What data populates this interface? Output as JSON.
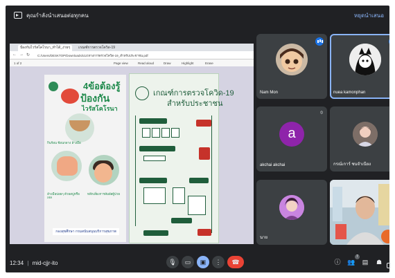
{
  "meeting": {
    "presenting_banner": "คุณกำลังนำเสนอต่อทุกคน",
    "stop_presenting": "หยุดนำเสนอ",
    "time": "12:34",
    "meeting_code": "mid-cjjr-ito",
    "participants_count": "7"
  },
  "shared_screen": {
    "tabs": [
      "ป้องกันไวรัสโคโรนา_ทำได้_ง่ายๆ",
      "เกณฑ์การตรวจโควิด-19"
    ],
    "address": "C:/Users/DESKTOP/Downloads/แนวทางการตรวจโควิด-19_สำหรับประชาชน.pdf",
    "page_indicator": "1 of 2",
    "toolbar": [
      "Page view",
      "Read aloud",
      "Draw",
      "Highlight",
      "Erase"
    ],
    "poster_left": {
      "title_line1": "4ข้อต้องรู้",
      "title_line2": "ป้องกัน",
      "title_line3": "ไวรัสโคโรนา",
      "tip1": "กินร้อน ช้อนกลาง ล้างมือ",
      "tip3": "ล้างมือบ่อยๆ ด้วยสบู่หรือเจล",
      "tip4": "หลีกเลี่ยงการสัมผัสผู้ป่วย",
      "footer": "กองสุขศึกษา กรมสนับสนุนบริการสุขภาพ"
    },
    "poster_right": {
      "title_line1": "เกณฑ์การตรวจโควิด-19",
      "title_line2": "สำหรับประชาชน"
    }
  },
  "participants": [
    {
      "name": "Nam Mon",
      "status": "speaking"
    },
    {
      "name": "nuea kamonphan",
      "status": "speaking",
      "initial": ""
    },
    {
      "name": "akchai akchai",
      "initial": "a",
      "status": "muted"
    },
    {
      "name": "กรณ์เการ์ ชนจำเนียง",
      "status": "muted"
    },
    {
      "name": "นาย",
      "status": ""
    },
    {
      "name": "",
      "status": ""
    }
  ],
  "colors": {
    "background": "#202124",
    "tile": "#3c4043",
    "accent": "#8ab4f8",
    "end_call": "#ea4335",
    "avatar_purple": "#8e24aa"
  },
  "controls": {
    "mic_icon": "mic-icon",
    "camera_icon": "camera-icon",
    "present_icon": "present-icon",
    "more_icon": "more-vert-icon",
    "end_icon": "end-call-icon",
    "info_icon": "info-icon",
    "people_icon": "people-icon",
    "chat_icon": "chat-icon",
    "activities_icon": "activities-icon",
    "lock_icon": "host-controls-icon"
  }
}
